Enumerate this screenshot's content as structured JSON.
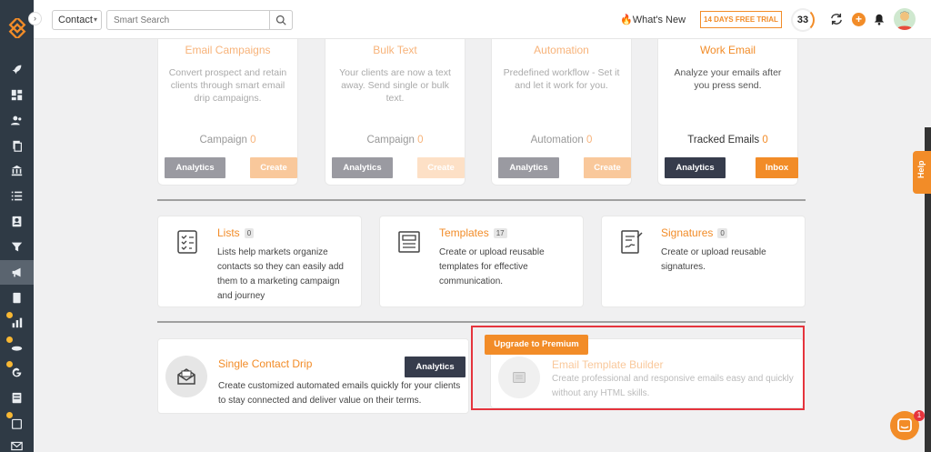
{
  "header": {
    "contact_select": "Contact",
    "search_placeholder": "Smart Search",
    "whats_new": "What's New",
    "trial": "14 DAYS FREE TRIAL",
    "score": "33"
  },
  "top_cards": [
    {
      "title": "Email Campaigns",
      "desc": "Convert prospect and retain clients through smart email drip campaigns.",
      "count_label": "Campaign",
      "count": "0",
      "analytics": "Analytics",
      "action": "Create"
    },
    {
      "title": "Bulk Text",
      "desc": "Your clients are now a text away. Send single or bulk text.",
      "count_label": "Campaign",
      "count": "0",
      "analytics": "Analytics",
      "action": "Create"
    },
    {
      "title": "Automation",
      "desc": "Predefined workflow - Set it and let it work for you.",
      "count_label": "Automation",
      "count": "0",
      "analytics": "Analytics",
      "action": "Create"
    },
    {
      "title": "Work Email",
      "desc": "Analyze your emails after you press send.",
      "count_label": "Tracked Emails",
      "count": "0",
      "analytics": "Analytics",
      "action": "Inbox"
    }
  ],
  "mid_cards": [
    {
      "title": "Lists",
      "badge": "0",
      "desc": "Lists help markets organize contacts so they can easily add them to a marketing campaign and journey"
    },
    {
      "title": "Templates",
      "badge": "17",
      "desc": "Create or upload reusable templates for effective communication."
    },
    {
      "title": "Signatures",
      "badge": "0",
      "desc": "Create or upload reusable signatures."
    }
  ],
  "drip": {
    "title": "Single Contact Drip",
    "desc": "Create customized automated emails quickly for your clients to stay connected and deliver value on their terms.",
    "analytics": "Analytics"
  },
  "builder": {
    "premium": "Upgrade to Premium",
    "title": "Email Template Builder",
    "desc": "Create professional and responsive emails easy and quickly without any HTML skills."
  },
  "help": "Help",
  "chat_badge": "1",
  "colors": {
    "accent": "#f28c28",
    "sidebar": "#2f3a45",
    "dark_button": "#363c4c",
    "highlight": "#e5343d"
  }
}
